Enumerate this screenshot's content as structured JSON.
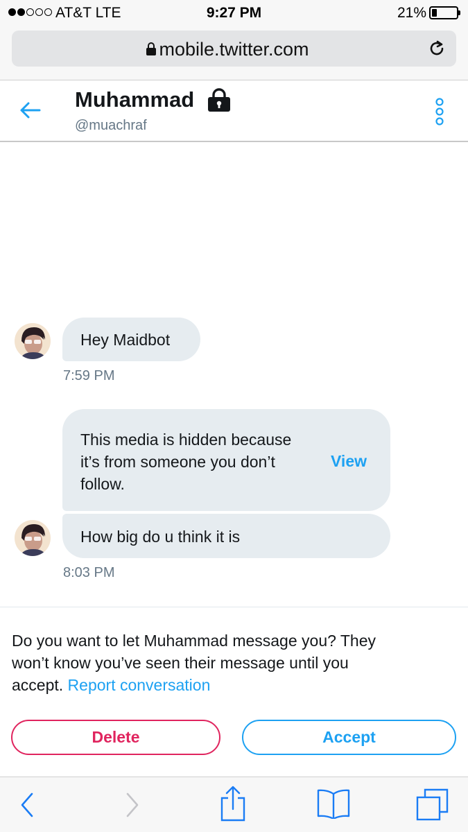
{
  "status_bar": {
    "carrier": "AT&T   LTE",
    "time": "9:27 PM",
    "battery_percent": "21%",
    "battery_level": 0.21,
    "signal_bars": 2,
    "signal_total": 5
  },
  "browser": {
    "url": "mobile.twitter.com",
    "lock_icon": "lock-icon",
    "reload_icon": "reload-icon"
  },
  "header": {
    "name": "Muhammad",
    "handle": "@muachraf",
    "back_icon": "back-arrow-icon",
    "protected_icon": "lock-icon",
    "more_icon": "vertical-dots-icon"
  },
  "messages": [
    {
      "text": "Hey Maidbot",
      "time": "7:59 PM"
    },
    {
      "media_notice": [
        "This media is hidden because",
        "it’s from someone you don’t",
        "follow."
      ],
      "view_label": "View"
    },
    {
      "text": "How big do u think it is",
      "time": "8:03 PM"
    }
  ],
  "prompt": {
    "line1": "Do you want to let Muhammad message you? They",
    "line2": "won’t know you’ve seen their message until you",
    "line3": "accept.",
    "report_label": "Report conversation"
  },
  "actions": {
    "delete_label": "Delete",
    "accept_label": "Accept"
  },
  "colors": {
    "twitter_blue": "#1da1f2",
    "delete_red": "#e0245e",
    "bubble_bg": "#e6ecf0",
    "secondary_text": "#657786"
  },
  "toolbar": {
    "icons": [
      "back-chevron-icon",
      "forward-chevron-icon",
      "share-icon",
      "bookmarks-icon",
      "tabs-icon"
    ]
  }
}
